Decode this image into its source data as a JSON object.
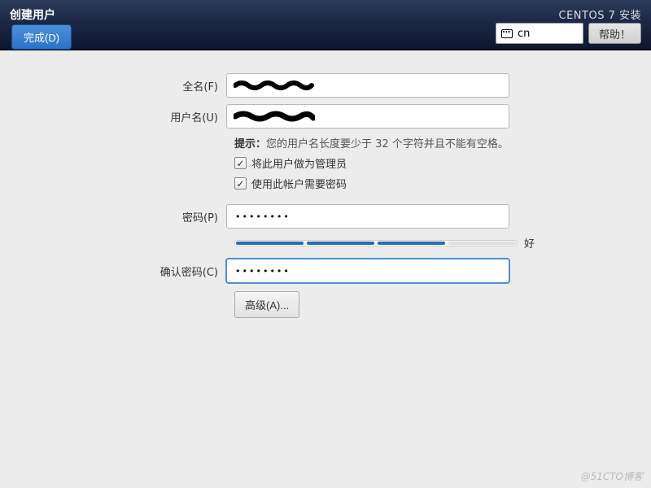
{
  "header": {
    "title": "创建用户",
    "installer_title": "CENTOS 7 安装",
    "done_button": "完成(D)",
    "help_button": "帮助！",
    "lang_selector": "cn"
  },
  "form": {
    "fullname_label": "全名(F)",
    "fullname_value": "",
    "username_label": "用户名(U)",
    "username_value": "",
    "hint_prefix": "提示：",
    "hint_text": "您的用户名长度要少于 32 个字符并且不能有空格。",
    "checkbox_admin": {
      "label": "将此用户做为管理员",
      "checked": true
    },
    "checkbox_require_pw": {
      "label": "使用此帐户需要密码",
      "checked": true
    },
    "password_label": "密码(P)",
    "password_value": "••••••••",
    "strength": {
      "filled_segments": 3,
      "total_segments": 4,
      "label": "好"
    },
    "confirm_label": "确认密码(C)",
    "confirm_value": "••••••••",
    "advanced_button": "高级(A)..."
  },
  "watermark": "@51CTO博客"
}
